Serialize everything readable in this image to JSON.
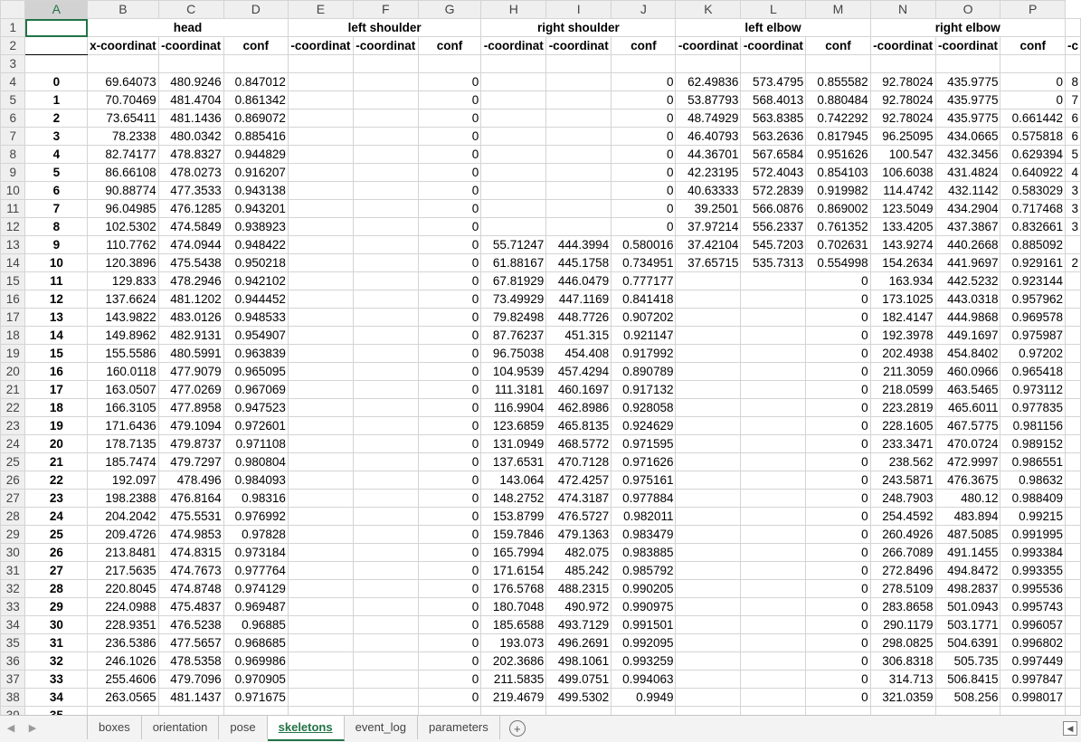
{
  "columns": [
    "A",
    "B",
    "C",
    "D",
    "E",
    "F",
    "G",
    "H",
    "I",
    "J",
    "K",
    "L",
    "M",
    "N",
    "O",
    "P"
  ],
  "group_row": {
    "row_num": "1",
    "groups": [
      {
        "label": "head"
      },
      {
        "label": "left shoulder"
      },
      {
        "label": "right shoulder"
      },
      {
        "label": "left elbow"
      },
      {
        "label": "right elbow"
      },
      {
        "label": ""
      }
    ]
  },
  "sub_row": {
    "row_num": "2",
    "labels": [
      "x-coordinat",
      "-coordinat",
      "conf",
      "-coordinat",
      "-coordinat",
      "conf",
      "-coordinat",
      "-coordinat",
      "conf",
      "-coordinat",
      "-coordinat",
      "conf",
      "-coordinat",
      "-coordinat",
      "conf",
      "-c"
    ]
  },
  "empty_row": {
    "row_num": "3"
  },
  "rows": [
    {
      "r": "4",
      "i": "0",
      "c": [
        "69.64073",
        "480.9246",
        "0.847012",
        "",
        "",
        "0",
        "",
        "",
        "0",
        "62.49836",
        "573.4795",
        "0.855582",
        "92.78024",
        "435.9775",
        "0",
        "8"
      ]
    },
    {
      "r": "5",
      "i": "1",
      "c": [
        "70.70469",
        "481.4704",
        "0.861342",
        "",
        "",
        "0",
        "",
        "",
        "0",
        "53.87793",
        "568.4013",
        "0.880484",
        "92.78024",
        "435.9775",
        "0",
        "7"
      ]
    },
    {
      "r": "6",
      "i": "2",
      "c": [
        "73.65411",
        "481.1436",
        "0.869072",
        "",
        "",
        "0",
        "",
        "",
        "0",
        "48.74929",
        "563.8385",
        "0.742292",
        "92.78024",
        "435.9775",
        "0.661442",
        "6"
      ]
    },
    {
      "r": "7",
      "i": "3",
      "c": [
        "78.2338",
        "480.0342",
        "0.885416",
        "",
        "",
        "0",
        "",
        "",
        "0",
        "46.40793",
        "563.2636",
        "0.817945",
        "96.25095",
        "434.0665",
        "0.575818",
        "6"
      ]
    },
    {
      "r": "8",
      "i": "4",
      "c": [
        "82.74177",
        "478.8327",
        "0.944829",
        "",
        "",
        "0",
        "",
        "",
        "0",
        "44.36701",
        "567.6584",
        "0.951626",
        "100.547",
        "432.3456",
        "0.629394",
        "5"
      ]
    },
    {
      "r": "9",
      "i": "5",
      "c": [
        "86.66108",
        "478.0273",
        "0.916207",
        "",
        "",
        "0",
        "",
        "",
        "0",
        "42.23195",
        "572.4043",
        "0.854103",
        "106.6038",
        "431.4824",
        "0.640922",
        "4"
      ]
    },
    {
      "r": "10",
      "i": "6",
      "c": [
        "90.88774",
        "477.3533",
        "0.943138",
        "",
        "",
        "0",
        "",
        "",
        "0",
        "40.63333",
        "572.2839",
        "0.919982",
        "114.4742",
        "432.1142",
        "0.583029",
        "3"
      ]
    },
    {
      "r": "11",
      "i": "7",
      "c": [
        "96.04985",
        "476.1285",
        "0.943201",
        "",
        "",
        "0",
        "",
        "",
        "0",
        "39.2501",
        "566.0876",
        "0.869002",
        "123.5049",
        "434.2904",
        "0.717468",
        "3"
      ]
    },
    {
      "r": "12",
      "i": "8",
      "c": [
        "102.5302",
        "474.5849",
        "0.938923",
        "",
        "",
        "0",
        "",
        "",
        "0",
        "37.97214",
        "556.2337",
        "0.761352",
        "133.4205",
        "437.3867",
        "0.832661",
        "3"
      ]
    },
    {
      "r": "13",
      "i": "9",
      "c": [
        "110.7762",
        "474.0944",
        "0.948422",
        "",
        "",
        "0",
        "55.71247",
        "444.3994",
        "0.580016",
        "37.42104",
        "545.7203",
        "0.702631",
        "143.9274",
        "440.2668",
        "0.885092",
        ""
      ]
    },
    {
      "r": "14",
      "i": "10",
      "c": [
        "120.3896",
        "475.5438",
        "0.950218",
        "",
        "",
        "0",
        "61.88167",
        "445.1758",
        "0.734951",
        "37.65715",
        "535.7313",
        "0.554998",
        "154.2634",
        "441.9697",
        "0.929161",
        "2"
      ]
    },
    {
      "r": "15",
      "i": "11",
      "c": [
        "129.833",
        "478.2946",
        "0.942102",
        "",
        "",
        "0",
        "67.81929",
        "446.0479",
        "0.777177",
        "",
        "",
        "0",
        "163.934",
        "442.5232",
        "0.923144",
        ""
      ]
    },
    {
      "r": "16",
      "i": "12",
      "c": [
        "137.6624",
        "481.1202",
        "0.944452",
        "",
        "",
        "0",
        "73.49929",
        "447.1169",
        "0.841418",
        "",
        "",
        "0",
        "173.1025",
        "443.0318",
        "0.957962",
        ""
      ]
    },
    {
      "r": "17",
      "i": "13",
      "c": [
        "143.9822",
        "483.0126",
        "0.948533",
        "",
        "",
        "0",
        "79.82498",
        "448.7726",
        "0.907202",
        "",
        "",
        "0",
        "182.4147",
        "444.9868",
        "0.969578",
        ""
      ]
    },
    {
      "r": "18",
      "i": "14",
      "c": [
        "149.8962",
        "482.9131",
        "0.954907",
        "",
        "",
        "0",
        "87.76237",
        "451.315",
        "0.921147",
        "",
        "",
        "0",
        "192.3978",
        "449.1697",
        "0.975987",
        ""
      ]
    },
    {
      "r": "19",
      "i": "15",
      "c": [
        "155.5586",
        "480.5991",
        "0.963839",
        "",
        "",
        "0",
        "96.75038",
        "454.408",
        "0.917992",
        "",
        "",
        "0",
        "202.4938",
        "454.8402",
        "0.97202",
        ""
      ]
    },
    {
      "r": "20",
      "i": "16",
      "c": [
        "160.0118",
        "477.9079",
        "0.965095",
        "",
        "",
        "0",
        "104.9539",
        "457.4294",
        "0.890789",
        "",
        "",
        "0",
        "211.3059",
        "460.0966",
        "0.965418",
        ""
      ]
    },
    {
      "r": "21",
      "i": "17",
      "c": [
        "163.0507",
        "477.0269",
        "0.967069",
        "",
        "",
        "0",
        "111.3181",
        "460.1697",
        "0.917132",
        "",
        "",
        "0",
        "218.0599",
        "463.5465",
        "0.973112",
        ""
      ]
    },
    {
      "r": "22",
      "i": "18",
      "c": [
        "166.3105",
        "477.8958",
        "0.947523",
        "",
        "",
        "0",
        "116.9904",
        "462.8986",
        "0.928058",
        "",
        "",
        "0",
        "223.2819",
        "465.6011",
        "0.977835",
        ""
      ]
    },
    {
      "r": "23",
      "i": "19",
      "c": [
        "171.6436",
        "479.1094",
        "0.972601",
        "",
        "",
        "0",
        "123.6859",
        "465.8135",
        "0.924629",
        "",
        "",
        "0",
        "228.1605",
        "467.5775",
        "0.981156",
        ""
      ]
    },
    {
      "r": "24",
      "i": "20",
      "c": [
        "178.7135",
        "479.8737",
        "0.971108",
        "",
        "",
        "0",
        "131.0949",
        "468.5772",
        "0.971595",
        "",
        "",
        "0",
        "233.3471",
        "470.0724",
        "0.989152",
        ""
      ]
    },
    {
      "r": "25",
      "i": "21",
      "c": [
        "185.7474",
        "479.7297",
        "0.980804",
        "",
        "",
        "0",
        "137.6531",
        "470.7128",
        "0.971626",
        "",
        "",
        "0",
        "238.562",
        "472.9997",
        "0.986551",
        ""
      ]
    },
    {
      "r": "26",
      "i": "22",
      "c": [
        "192.097",
        "478.496",
        "0.984093",
        "",
        "",
        "0",
        "143.064",
        "472.4257",
        "0.975161",
        "",
        "",
        "0",
        "243.5871",
        "476.3675",
        "0.98632",
        ""
      ]
    },
    {
      "r": "27",
      "i": "23",
      "c": [
        "198.2388",
        "476.8164",
        "0.98316",
        "",
        "",
        "0",
        "148.2752",
        "474.3187",
        "0.977884",
        "",
        "",
        "0",
        "248.7903",
        "480.12",
        "0.988409",
        ""
      ]
    },
    {
      "r": "28",
      "i": "24",
      "c": [
        "204.2042",
        "475.5531",
        "0.976992",
        "",
        "",
        "0",
        "153.8799",
        "476.5727",
        "0.982011",
        "",
        "",
        "0",
        "254.4592",
        "483.894",
        "0.99215",
        ""
      ]
    },
    {
      "r": "29",
      "i": "25",
      "c": [
        "209.4726",
        "474.9853",
        "0.97828",
        "",
        "",
        "0",
        "159.7846",
        "479.1363",
        "0.983479",
        "",
        "",
        "0",
        "260.4926",
        "487.5085",
        "0.991995",
        ""
      ]
    },
    {
      "r": "30",
      "i": "26",
      "c": [
        "213.8481",
        "474.8315",
        "0.973184",
        "",
        "",
        "0",
        "165.7994",
        "482.075",
        "0.983885",
        "",
        "",
        "0",
        "266.7089",
        "491.1455",
        "0.993384",
        ""
      ]
    },
    {
      "r": "31",
      "i": "27",
      "c": [
        "217.5635",
        "474.7673",
        "0.977764",
        "",
        "",
        "0",
        "171.6154",
        "485.242",
        "0.985792",
        "",
        "",
        "0",
        "272.8496",
        "494.8472",
        "0.993355",
        ""
      ]
    },
    {
      "r": "32",
      "i": "28",
      "c": [
        "220.8045",
        "474.8748",
        "0.974129",
        "",
        "",
        "0",
        "176.5768",
        "488.2315",
        "0.990205",
        "",
        "",
        "0",
        "278.5109",
        "498.2837",
        "0.995536",
        ""
      ]
    },
    {
      "r": "33",
      "i": "29",
      "c": [
        "224.0988",
        "475.4837",
        "0.969487",
        "",
        "",
        "0",
        "180.7048",
        "490.972",
        "0.990975",
        "",
        "",
        "0",
        "283.8658",
        "501.0943",
        "0.995743",
        ""
      ]
    },
    {
      "r": "34",
      "i": "30",
      "c": [
        "228.9351",
        "476.5238",
        "0.96885",
        "",
        "",
        "0",
        "185.6588",
        "493.7129",
        "0.991501",
        "",
        "",
        "0",
        "290.1179",
        "503.1771",
        "0.996057",
        ""
      ]
    },
    {
      "r": "35",
      "i": "31",
      "c": [
        "236.5386",
        "477.5657",
        "0.968685",
        "",
        "",
        "0",
        "193.073",
        "496.2691",
        "0.992095",
        "",
        "",
        "0",
        "298.0825",
        "504.6391",
        "0.996802",
        ""
      ]
    },
    {
      "r": "36",
      "i": "32",
      "c": [
        "246.1026",
        "478.5358",
        "0.969986",
        "",
        "",
        "0",
        "202.3686",
        "498.1061",
        "0.993259",
        "",
        "",
        "0",
        "306.8318",
        "505.735",
        "0.997449",
        ""
      ]
    },
    {
      "r": "37",
      "i": "33",
      "c": [
        "255.4606",
        "479.7096",
        "0.970905",
        "",
        "",
        "0",
        "211.5835",
        "499.0751",
        "0.994063",
        "",
        "",
        "0",
        "314.713",
        "506.8415",
        "0.997847",
        ""
      ]
    },
    {
      "r": "38",
      "i": "34",
      "c": [
        "263.0565",
        "481.1437",
        "0.971675",
        "",
        "",
        "0",
        "219.4679",
        "499.5302",
        "0.9949",
        "",
        "",
        "0",
        "321.0359",
        "508.256",
        "0.998017",
        ""
      ]
    },
    {
      "r": "39",
      "i": "35",
      "c": [
        "",
        "",
        "",
        "",
        "",
        "",
        "",
        "",
        "",
        "",
        "",
        "",
        "",
        "",
        "",
        ""
      ]
    }
  ],
  "sheet_tabs": [
    "boxes",
    "orientation",
    "pose",
    "skeletons",
    "event_log",
    "parameters"
  ],
  "active_tab": "skeletons",
  "nav": {
    "prev": "◀",
    "next": "▶",
    "ellipsis": "...",
    "add": "+",
    "scroll": "◀"
  }
}
